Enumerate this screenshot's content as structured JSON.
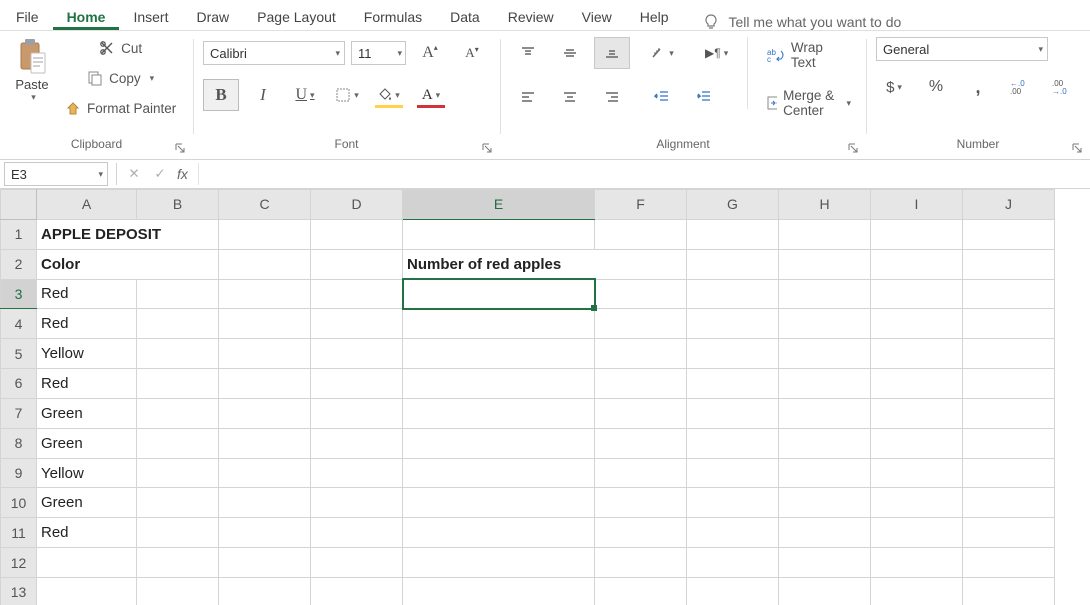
{
  "menu": {
    "items": [
      "File",
      "Home",
      "Insert",
      "Draw",
      "Page Layout",
      "Formulas",
      "Data",
      "Review",
      "View",
      "Help"
    ],
    "active_index": 1,
    "tell": "Tell me what you want to do"
  },
  "ribbon": {
    "clipboard": {
      "label": "Clipboard",
      "paste": "Paste",
      "cut": "Cut",
      "copy": "Copy",
      "format_painter": "Format Painter"
    },
    "font": {
      "label": "Font",
      "name": "Calibri",
      "size": "11",
      "bold": "B",
      "italic": "I",
      "underline": "U",
      "font_color": "A",
      "inc": "A",
      "dec": "A"
    },
    "alignment": {
      "label": "Alignment",
      "wrap": "Wrap Text",
      "merge": "Merge & Center"
    },
    "number": {
      "label": "Number",
      "format": "General",
      "currency": "$",
      "percent": "%",
      "comma": ",",
      "inc_dec": ".0",
      "dec_dec": ".00"
    }
  },
  "namebar": {
    "cell": "E3",
    "fx": "fx",
    "formula": ""
  },
  "grid": {
    "columns": [
      "A",
      "B",
      "C",
      "D",
      "E",
      "F",
      "G",
      "H",
      "I",
      "J"
    ],
    "rows": 13,
    "widths": {
      "A": 100,
      "B": 82,
      "C": 92,
      "D": 92,
      "E": 192,
      "F": 92,
      "G": 92,
      "H": 92,
      "I": 92,
      "J": 92
    },
    "selected": "E3",
    "cells": {
      "A1": {
        "v": "APPLE DEPOSIT",
        "cls": "hdr1",
        "span": 2
      },
      "A2": {
        "v": "Color",
        "cls": "hdr2",
        "span": 2
      },
      "E2": {
        "v": "Number of red apples",
        "cls": "bold",
        "span": 2
      },
      "A3": {
        "v": "Red"
      },
      "A4": {
        "v": "Red"
      },
      "A5": {
        "v": "Yellow"
      },
      "A6": {
        "v": "Red"
      },
      "A7": {
        "v": "Green"
      },
      "A8": {
        "v": "Green"
      },
      "A9": {
        "v": "Yellow"
      },
      "A10": {
        "v": "Green"
      },
      "A11": {
        "v": "Red"
      }
    }
  }
}
